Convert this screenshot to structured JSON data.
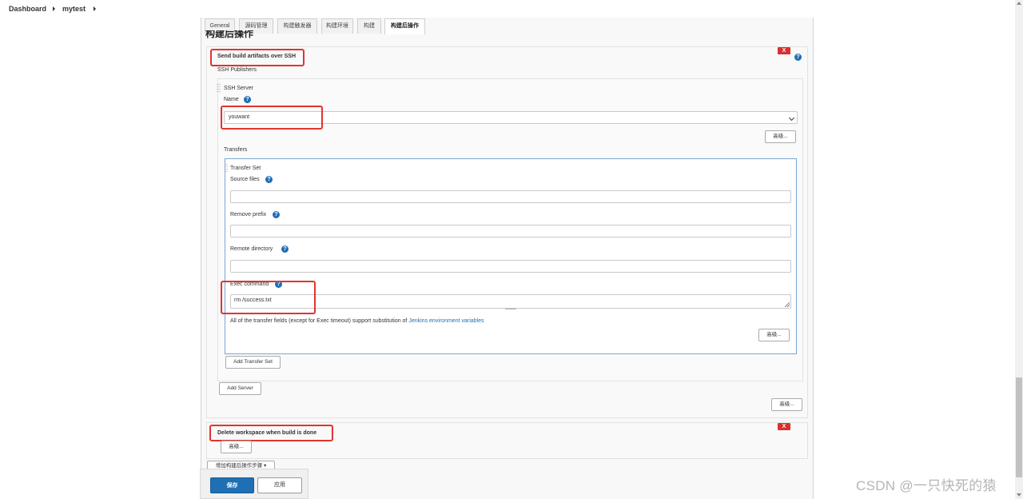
{
  "breadcrumb": {
    "items": [
      {
        "label": "Dashboard"
      },
      {
        "label": "mytest"
      }
    ]
  },
  "tabs": [
    {
      "label": "General"
    },
    {
      "label": "源码管理"
    },
    {
      "label": "构建触发器"
    },
    {
      "label": "构建环境"
    },
    {
      "label": "构建"
    },
    {
      "label": "构建后操作",
      "active": true
    }
  ],
  "section": {
    "title": "构建后操作"
  },
  "ssh_plugin": {
    "title": "Send build artifacts over SSH",
    "delete_label": "X",
    "publishers_label": "SSH Publishers",
    "server_label": "SSH Server",
    "name_label": "Name",
    "name_value": "youwant",
    "advanced_label": "高级...",
    "transfers_label": "Transfers",
    "transfer_set": {
      "title": "Transfer Set",
      "source_files_label": "Source files",
      "source_files_value": "",
      "remove_prefix_label": "Remove prefix",
      "remove_prefix_value": "",
      "remote_directory_label": "Remote directory",
      "remote_directory_value": "",
      "exec_command_label": "Exec command",
      "exec_command_value": "rm /success.txt",
      "note_text": "All of the transfer fields (except for Exec timeout) support substitution of ",
      "note_link": "Jenkins environment variables",
      "advanced_label": "高级..."
    },
    "add_transfer_set_label": "Add Transfer Set",
    "add_server_label": "Add Server",
    "outer_advanced_label": "高级..."
  },
  "delete_workspace": {
    "title": "Delete workspace when build is done",
    "delete_label": "X",
    "advanced_label": "高级..."
  },
  "add_post_build": {
    "label": "增加构建后操作步骤 ▾"
  },
  "actions": {
    "save_label": "保存",
    "apply_label": "应用"
  },
  "watermark": {
    "text": "CSDN @一只快死的猿"
  },
  "colors": {
    "primary": "#1f6fb5",
    "danger": "#d63131",
    "highlight": "#e0342f"
  }
}
